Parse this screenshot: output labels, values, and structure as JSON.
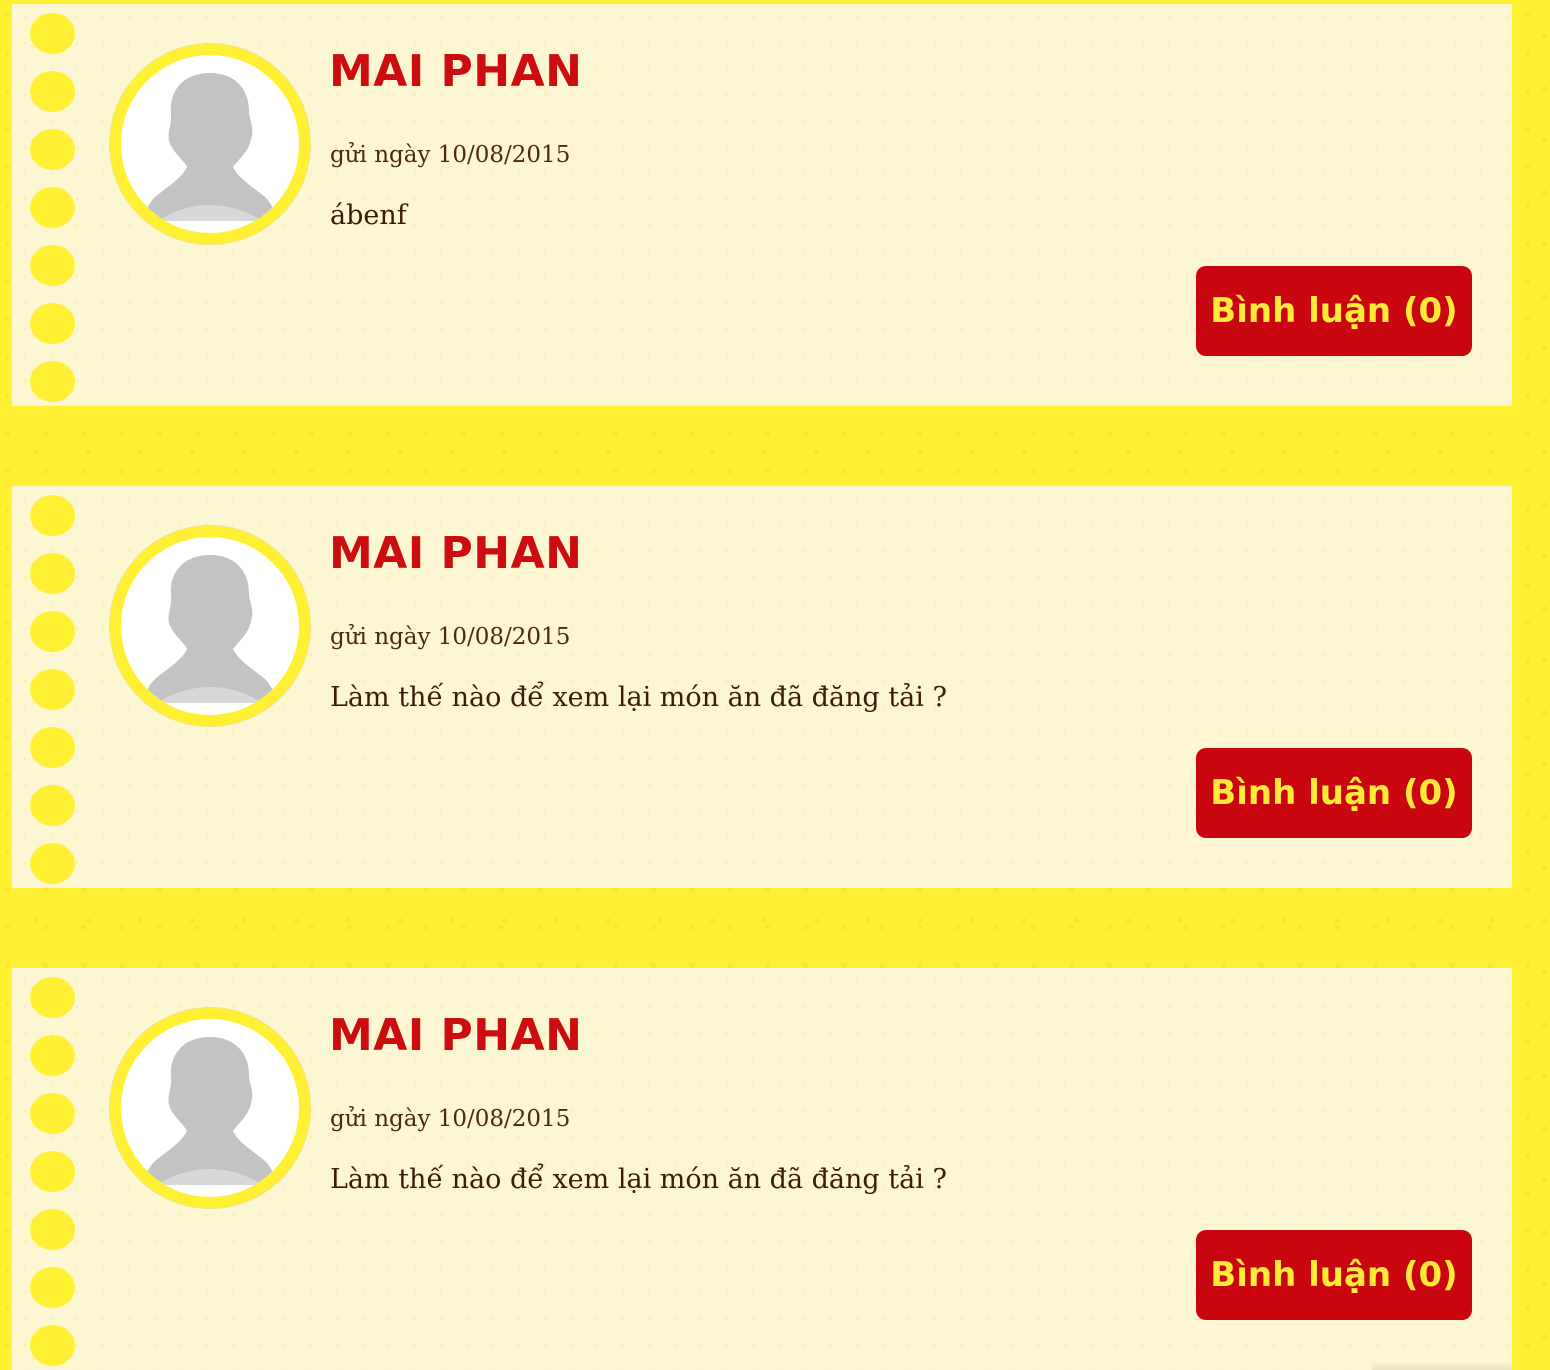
{
  "posts": [
    {
      "author": "MAI PHAN",
      "date_text": "gửi ngày 10/08/2015",
      "content": "ábenf",
      "comment_label": "Bình luận (0)"
    },
    {
      "author": "MAI PHAN",
      "date_text": "gửi ngày 10/08/2015",
      "content": "Làm thế nào để xem lại món ăn đã đăng tải ?",
      "comment_label": "Bình luận (0)"
    },
    {
      "author": "MAI PHAN",
      "date_text": "gửi ngày 10/08/2015",
      "content": "Làm thế nào để xem lại món ăn đã đăng tải ?",
      "comment_label": "Bình luận (0)"
    }
  ],
  "colors": {
    "page_background": "#fff033",
    "card_background": "#fdf6d2",
    "author_name": "#cc0d10",
    "button_background": "#c9060f",
    "button_text": "#ffea3a",
    "body_text": "#3a1c08"
  },
  "icons": {
    "avatar": "person-silhouette-icon",
    "binder_hole": "binder-hole-icon"
  }
}
